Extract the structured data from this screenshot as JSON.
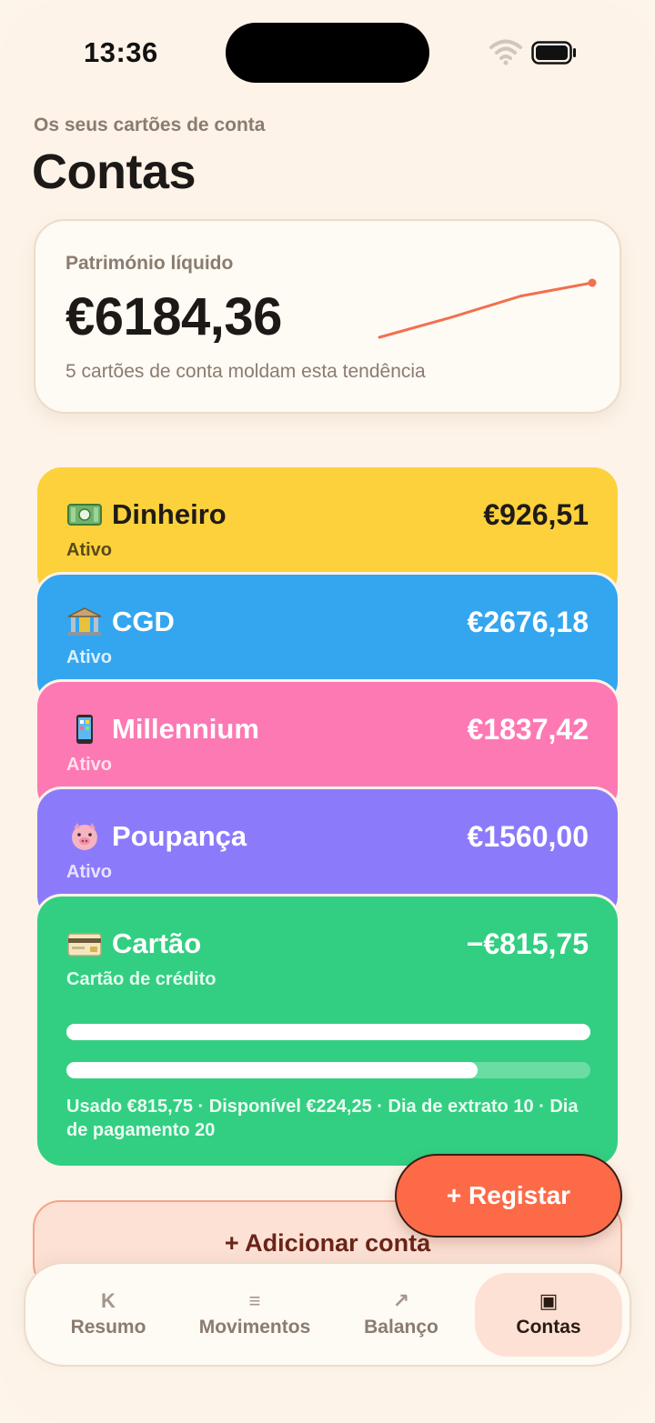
{
  "status_bar": {
    "time": "13:36"
  },
  "header": {
    "subtitle": "Os seus cartões de conta",
    "title": "Contas"
  },
  "net_worth": {
    "label": "Património líquido",
    "value": "€6184,36",
    "caption": "5 cartões de conta moldam esta tendência",
    "trend": [
      4800,
      5300,
      5850,
      6184.36
    ],
    "trend_color": "#f2704f"
  },
  "accounts": [
    {
      "icon": "banknote-icon",
      "name": "Dinheiro",
      "amount": "€926,51",
      "status": "Ativo",
      "color": "#fdd13b"
    },
    {
      "icon": "bank-icon",
      "name": "CGD",
      "amount": "€2676,18",
      "status": "Ativo",
      "color": "#34a6ef"
    },
    {
      "icon": "phone-icon",
      "name": "Millennium",
      "amount": "€1837,42",
      "status": "Ativo",
      "color": "#fd79b3"
    },
    {
      "icon": "piggy-icon",
      "name": "Poupança",
      "amount": "€1560,00",
      "status": "Ativo",
      "color": "#8b7bfb"
    },
    {
      "icon": "credit-card-icon",
      "name": "Cartão",
      "amount": "−€815,75",
      "status": "Cartão de crédito",
      "color": "#32cf82",
      "bar_top_fraction": 1.0,
      "used_fraction": 0.784,
      "details": "Usado €815,75 · Disponível €224,25 · Dia de extrato 10 · Dia de pagamento 20"
    }
  ],
  "add_account_label": "+ Adicionar conta",
  "fab_label": "+ Registar",
  "nav": [
    {
      "icon": "K",
      "label": "Resumo",
      "active": false
    },
    {
      "icon": "≡",
      "label": "Movimentos",
      "active": false
    },
    {
      "icon": "↗",
      "label": "Balanço",
      "active": false
    },
    {
      "icon": "▣",
      "label": "Contas",
      "active": true
    }
  ]
}
